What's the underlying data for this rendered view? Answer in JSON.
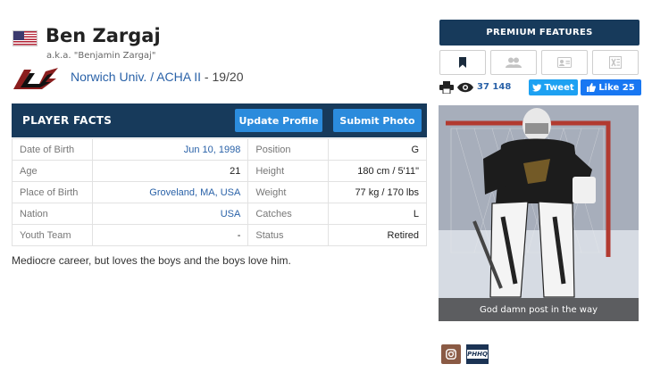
{
  "player": {
    "name": "Ben Zargaj",
    "aka": "a.k.a. \"Benjamin Zargaj\"",
    "team": "Norwich Univ. / ACHA II",
    "season": " - 19/20"
  },
  "facts": {
    "title": "PLAYER FACTS",
    "update_label": "Update Profile",
    "submit_label": "Submit Photo",
    "rows": [
      {
        "l1": "Date of Birth",
        "v1": "Jun 10, 1998",
        "l2": "Position",
        "v2": "G"
      },
      {
        "l1": "Age",
        "v1": "21",
        "l2": "Height",
        "v2": "180 cm / 5'11\""
      },
      {
        "l1": "Place of Birth",
        "v1": "Groveland, MA, USA",
        "l2": "Weight",
        "v2": "77 kg / 170 lbs"
      },
      {
        "l1": "Nation",
        "v1": "USA",
        "l2": "Catches",
        "v2": "L"
      },
      {
        "l1": "Youth Team",
        "v1": "-",
        "l2": "Status",
        "v2": "Retired"
      }
    ]
  },
  "bio": "Mediocre career, but loves the boys and the boys love him.",
  "sidebar": {
    "premium_label": "PREMIUM FEATURES",
    "feature_icons": [
      "bookmark-icon",
      "users-icon",
      "id-card-icon",
      "excel-icon"
    ],
    "views": "37 148",
    "tweet_label": "Tweet",
    "like_label": "Like 25",
    "photo_caption": "God damn post in the way",
    "phhq_label": "PHHQ"
  },
  "colors": {
    "navy": "#173a5b",
    "button_blue": "#2b8bdc",
    "link_blue": "#2a62a8",
    "twitter": "#1da1f2",
    "facebook": "#1877f2"
  }
}
